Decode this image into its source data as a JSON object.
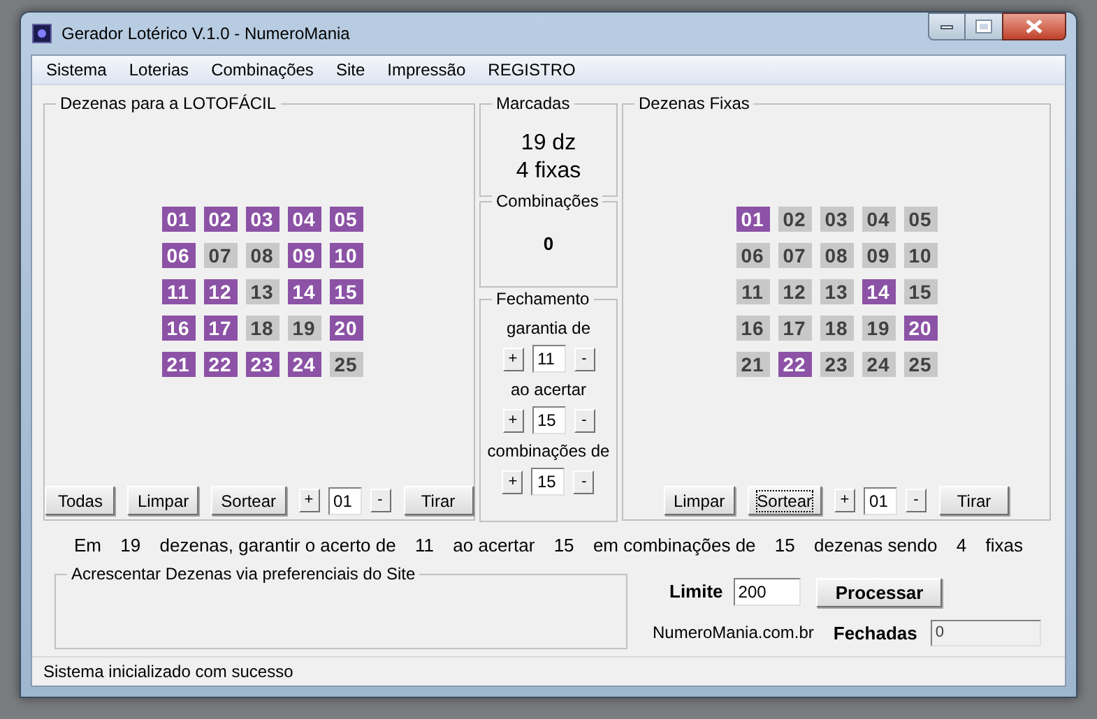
{
  "window": {
    "title": "Gerador Lotérico V.1.0 - NumeroMania"
  },
  "menu": [
    "Sistema",
    "Loterias",
    "Combinações",
    "Site",
    "Impressão",
    "REGISTRO"
  ],
  "left_panel": {
    "title": "Dezenas para a LOTOFÁCIL",
    "numbers": [
      {
        "label": "01",
        "selected": true
      },
      {
        "label": "02",
        "selected": true
      },
      {
        "label": "03",
        "selected": true
      },
      {
        "label": "04",
        "selected": true
      },
      {
        "label": "05",
        "selected": true
      },
      {
        "label": "06",
        "selected": true
      },
      {
        "label": "07",
        "selected": false
      },
      {
        "label": "08",
        "selected": false
      },
      {
        "label": "09",
        "selected": true
      },
      {
        "label": "10",
        "selected": true
      },
      {
        "label": "11",
        "selected": true
      },
      {
        "label": "12",
        "selected": true
      },
      {
        "label": "13",
        "selected": false
      },
      {
        "label": "14",
        "selected": true
      },
      {
        "label": "15",
        "selected": true
      },
      {
        "label": "16",
        "selected": true
      },
      {
        "label": "17",
        "selected": true
      },
      {
        "label": "18",
        "selected": false
      },
      {
        "label": "19",
        "selected": false
      },
      {
        "label": "20",
        "selected": true
      },
      {
        "label": "21",
        "selected": true
      },
      {
        "label": "22",
        "selected": true
      },
      {
        "label": "23",
        "selected": true
      },
      {
        "label": "24",
        "selected": true
      },
      {
        "label": "25",
        "selected": false
      }
    ],
    "controls": [
      {
        "kind": "button",
        "label": "Todas",
        "focused": false
      },
      {
        "kind": "button",
        "label": "Limpar",
        "focused": false
      },
      {
        "kind": "button",
        "label": "Sortear",
        "focused": false
      },
      {
        "kind": "spinner",
        "plus": "+",
        "value": "01",
        "minus": "-"
      },
      {
        "kind": "button",
        "label": "Tirar",
        "focused": false
      }
    ]
  },
  "marcadas": {
    "title": "Marcadas",
    "lines": [
      "19 dz",
      "4 fixas"
    ]
  },
  "combinacoes": {
    "title": "Combinações",
    "value": "0"
  },
  "fechamento": {
    "title": "Fechamento",
    "fields": [
      {
        "label": "garantia de",
        "plus": "+",
        "value": "11",
        "minus": "-"
      },
      {
        "label": "ao acertar",
        "plus": "+",
        "value": "15",
        "minus": "-"
      },
      {
        "label": "combinações de",
        "plus": "+",
        "value": "15",
        "minus": "-"
      }
    ]
  },
  "right_panel": {
    "title": "Dezenas Fixas",
    "numbers": [
      {
        "label": "01",
        "selected": true
      },
      {
        "label": "02",
        "selected": false
      },
      {
        "label": "03",
        "selected": false
      },
      {
        "label": "04",
        "selected": false
      },
      {
        "label": "05",
        "selected": false
      },
      {
        "label": "06",
        "selected": false
      },
      {
        "label": "07",
        "selected": false
      },
      {
        "label": "08",
        "selected": false
      },
      {
        "label": "09",
        "selected": false
      },
      {
        "label": "10",
        "selected": false
      },
      {
        "label": "11",
        "selected": false
      },
      {
        "label": "12",
        "selected": false
      },
      {
        "label": "13",
        "selected": false
      },
      {
        "label": "14",
        "selected": true
      },
      {
        "label": "15",
        "selected": false
      },
      {
        "label": "16",
        "selected": false
      },
      {
        "label": "17",
        "selected": false
      },
      {
        "label": "18",
        "selected": false
      },
      {
        "label": "19",
        "selected": false
      },
      {
        "label": "20",
        "selected": true
      },
      {
        "label": "21",
        "selected": false
      },
      {
        "label": "22",
        "selected": true
      },
      {
        "label": "23",
        "selected": false
      },
      {
        "label": "24",
        "selected": false
      },
      {
        "label": "25",
        "selected": false
      }
    ],
    "controls": [
      {
        "kind": "button",
        "label": "Limpar",
        "focused": false
      },
      {
        "kind": "button",
        "label": "Sortear",
        "focused": true
      },
      {
        "kind": "spinner",
        "plus": "+",
        "value": "01",
        "minus": "-"
      },
      {
        "kind": "button",
        "label": "Tirar",
        "focused": false
      }
    ]
  },
  "summary": [
    "Em",
    "19",
    "dezenas, garantir o acerto de",
    "11",
    "ao acertar",
    "15",
    "em combinações de",
    "15",
    "dezenas sendo",
    "4",
    "fixas"
  ],
  "site_box": {
    "title": "Acrescentar Dezenas via preferenciais do Site"
  },
  "limite": {
    "label": "Limite",
    "value": "200"
  },
  "processar": {
    "label": "Processar"
  },
  "site_link": "NumeroMania.com.br",
  "fechadas": {
    "label": "Fechadas",
    "value": "0"
  },
  "status_bar": "Sistema inicializado com sucesso"
}
